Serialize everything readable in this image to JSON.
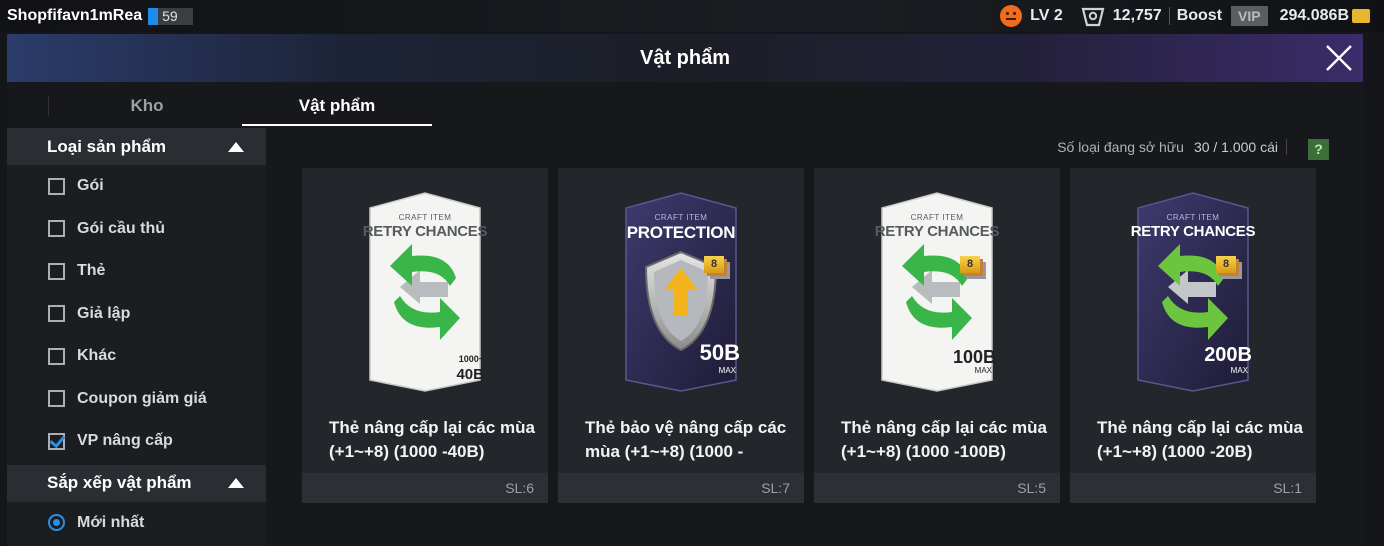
{
  "topbar": {
    "username": "Shopfifavn1mRea",
    "user_badge": "59",
    "level": "LV 2",
    "coins": "12,757",
    "boost_label": "Boost",
    "vip_label": "VIP",
    "bcash": "294.086B",
    "icons": [
      "mood-face-icon",
      "coin-icon",
      "bcash-icon"
    ]
  },
  "window": {
    "title": "Vật phẩm"
  },
  "tabs": [
    {
      "label": "Kho",
      "active": false
    },
    {
      "label": "Vật phẩm",
      "active": true
    }
  ],
  "sidebar": {
    "product_type": {
      "header": "Loại sản phẩm",
      "options": [
        {
          "label": "Gói",
          "checked": false
        },
        {
          "label": "Gói cầu thủ",
          "checked": false
        },
        {
          "label": "Thẻ",
          "checked": false
        },
        {
          "label": "Giả lập",
          "checked": false
        },
        {
          "label": "Khác",
          "checked": false
        },
        {
          "label": "Coupon giảm giá",
          "checked": false
        },
        {
          "label": "VP nâng cấp",
          "checked": true
        }
      ]
    },
    "sort": {
      "header": "Sắp xếp vật phẩm",
      "options": [
        {
          "label": "Mới nhất",
          "selected": true
        }
      ]
    }
  },
  "owned": {
    "label": "Số loại đang sở hữu",
    "count": "30 / 1.000 cái",
    "help": "?"
  },
  "items": [
    {
      "craft_label": "CRAFT ITEM",
      "card_title": "RETRY CHANCES",
      "style": "light",
      "price": "1000~",
      "price2": "40B",
      "max_label": "",
      "level_badge": "",
      "name": "Thẻ nâng cấp lại các mùa (+1~+8) (1000 -40B)",
      "qty": "SL:6"
    },
    {
      "craft_label": "CRAFT ITEM",
      "card_title": "PROTECTION",
      "style": "dark",
      "price": "",
      "price2": "50B",
      "max_label": "MAX",
      "level_badge": "8",
      "name": "Thẻ bảo vệ nâng cấp các mùa (+1~+8) (1000 -",
      "qty": "SL:7"
    },
    {
      "craft_label": "CRAFT ITEM",
      "card_title": "RETRY CHANCES",
      "style": "light",
      "price": "",
      "price2": "100B",
      "max_label": "MAX",
      "level_badge": "8",
      "name": "Thẻ nâng cấp lại các mùa (+1~+8) (1000 -100B)",
      "qty": "SL:5"
    },
    {
      "craft_label": "CRAFT ITEM",
      "card_title": "RETRY CHANCES",
      "style": "dark",
      "price": "",
      "price2": "200B",
      "max_label": "MAX",
      "level_badge": "8",
      "name": "Thẻ nâng cấp lại các mùa (+1~+8) (1000 -20B)",
      "qty": "SL:1"
    }
  ],
  "colors": {
    "accent_blue": "#2a8fe6",
    "bcash_gold": "#e8b531",
    "level_orange": "#f26a1b"
  }
}
